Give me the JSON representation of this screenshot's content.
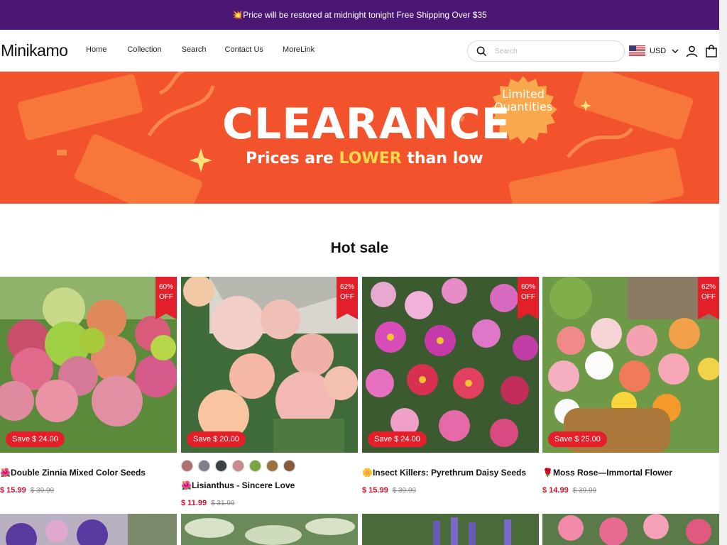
{
  "announcement": "💥Price will be restored at midnight tonight Free Shipping Over $35",
  "header": {
    "logo": "Minikamo",
    "nav": [
      "Home",
      "Collection",
      "Search",
      "Contact Us",
      "MoreLink"
    ],
    "search_placeholder": "Search",
    "currency": "USD"
  },
  "hero": {
    "title": "CLEARANCE",
    "subtitle_pre": "Prices are ",
    "subtitle_em": "LOWER",
    "subtitle_post": " than low",
    "badge_line1": "Limited",
    "badge_line2": "Quantities",
    "bg_color": "#f2532c"
  },
  "section_title": "Hot sale",
  "products": [
    {
      "title": "🌺Double Zinnia Mixed Color Seeds",
      "price": "$ 15.99",
      "compare": "$ 39.99",
      "off_pct": "60%",
      "off_label": "OFF",
      "save": "Save $ 24.00"
    },
    {
      "title": "🌺Lisianthus - Sincere Love",
      "price": "$ 11.99",
      "compare": "$ 31.99",
      "off_pct": "62%",
      "off_label": "OFF",
      "save": "Save $ 20.00"
    },
    {
      "title": "🌼Insect Killers: Pyrethrum Daisy Seeds",
      "price": "$ 15.99",
      "compare": "$ 39.99",
      "off_pct": "60%",
      "off_label": "OFF",
      "save": "Save $ 24.00"
    },
    {
      "title": "🌹Moss Rose—Immortal Flower",
      "price": "$ 14.99",
      "compare": "$ 39.99",
      "off_pct": "62%",
      "off_label": "OFF",
      "save": "Save $ 25.00"
    }
  ],
  "colors": {
    "announcement_bg": "#4a1874",
    "sale_red": "#e3202a",
    "price_red": "#c8102e"
  },
  "icons": [
    "search-icon",
    "us-flag-icon",
    "chevron-down-icon",
    "user-icon",
    "shopping-bag-icon"
  ]
}
